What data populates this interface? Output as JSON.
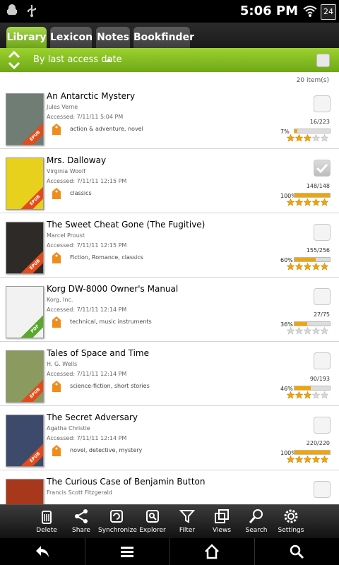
{
  "status": {
    "time": "5:06 PM",
    "battery": "24"
  },
  "tabs": [
    {
      "label": "Library",
      "active": true
    },
    {
      "label": "Lexicon",
      "active": false
    },
    {
      "label": "Notes",
      "active": false
    },
    {
      "label": "Bookfinder",
      "active": false
    }
  ],
  "sort": {
    "label": "By last access date"
  },
  "item_count": "20 item(s)",
  "books": [
    {
      "title": "An Antarctic Mystery",
      "author": "Jules Verne",
      "accessed": "Accessed: 7/11/11 5:04 PM",
      "tags": "action & adventure, novel",
      "pages": "16/223",
      "percent": "7%",
      "progress": 0.07,
      "rating": 3,
      "checked": false,
      "format": "EPUB",
      "cover_color": "#6f7d74",
      "ribbon_color": "#e34b1a"
    },
    {
      "title": "Mrs. Dalloway",
      "author": "Virginia Woolf",
      "accessed": "Accessed: 7/11/11 12:15 PM",
      "tags": "classics",
      "pages": "148/148",
      "percent": "100%",
      "progress": 1.0,
      "rating": 5,
      "checked": true,
      "format": "EPUB",
      "cover_color": "#e8d11c",
      "ribbon_color": "#e34b1a"
    },
    {
      "title": "The Sweet Cheat Gone (The Fugitive)",
      "author": "Marcel Proust",
      "accessed": "Accessed: 7/11/11 12:15 PM",
      "tags": "Fiction, Romance, classics",
      "pages": "155/256",
      "percent": "60%",
      "progress": 0.6,
      "rating": 5,
      "checked": false,
      "format": "EPUB",
      "cover_color": "#2d2a28",
      "ribbon_color": "#e34b1a"
    },
    {
      "title": "Korg DW-8000 Owner's Manual",
      "author": "Korg, Inc.",
      "accessed": "Accessed: 7/11/11 12:14 PM",
      "tags": "technical, music instruments",
      "pages": "27/75",
      "percent": "36%",
      "progress": 0.36,
      "rating": 0,
      "checked": false,
      "format": "PDF",
      "cover_color": "#f2f2f2",
      "ribbon_color": "#5aa82d"
    },
    {
      "title": "Tales of Space and Time",
      "author": "H. G. Wells",
      "accessed": "Accessed: 7/11/11 12:14 PM",
      "tags": "science-fiction, short stories",
      "pages": "90/193",
      "percent": "46%",
      "progress": 0.46,
      "rating": 3,
      "checked": false,
      "format": "EPUB",
      "cover_color": "#8b9a5e",
      "ribbon_color": "#e34b1a"
    },
    {
      "title": "The Secret Adversary",
      "author": "Agatha Christie",
      "accessed": "Accessed: 7/11/11 12:14 PM",
      "tags": "novel, detective, mystery",
      "pages": "220/220",
      "percent": "100%",
      "progress": 1.0,
      "rating": 5,
      "checked": false,
      "format": "EPUB",
      "cover_color": "#3d4a6b",
      "ribbon_color": "#e34b1a"
    },
    {
      "title": "The Curious Case of Benjamin Button",
      "author": "Francis Scott Fitzgerald",
      "accessed": "",
      "tags": "",
      "pages": "",
      "percent": "",
      "progress": 0,
      "rating": 0,
      "checked": false,
      "format": "",
      "cover_color": "#a8381c",
      "ribbon_color": "#e34b1a"
    }
  ],
  "toolbar": [
    {
      "label": "Delete",
      "icon": "trash-icon"
    },
    {
      "label": "Share",
      "icon": "share-icon"
    },
    {
      "label": "Synchronize",
      "icon": "sync-icon"
    },
    {
      "label": "Explorer",
      "icon": "folder-icon"
    },
    {
      "label": "Filter",
      "icon": "filter-icon"
    },
    {
      "label": "Views",
      "icon": "views-icon"
    },
    {
      "label": "Search",
      "icon": "search-icon"
    },
    {
      "label": "Settings",
      "icon": "gear-icon"
    }
  ],
  "colors": {
    "accent": "#8bc624",
    "star": "#f2a500"
  }
}
